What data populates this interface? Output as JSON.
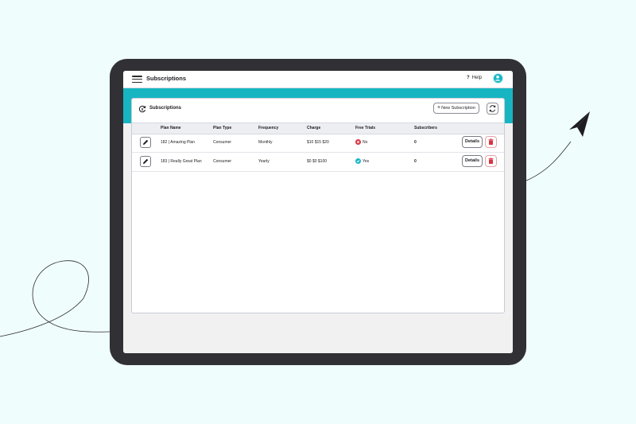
{
  "app": {
    "title": "Subscriptions",
    "help_label": "Help"
  },
  "panel": {
    "title": "Subscriptions",
    "new_button_label": "New Subscription"
  },
  "table": {
    "columns": [
      "Plan Name",
      "Plan Type",
      "Frequency",
      "Charge",
      "Free Trials",
      "Subscribers"
    ],
    "rows": [
      {
        "plan_name": "182 | Amazing Plan",
        "plan_type": "Consumer",
        "frequency": "Monthly",
        "charge": "$10 $15 $20",
        "free_trials": "No",
        "free_trial_status": "no",
        "subscribers": "0",
        "details_label": "Details"
      },
      {
        "plan_name": "183 | Really Great Plan",
        "plan_type": "Consumer",
        "frequency": "Yearly",
        "charge": "$0 $0 $100",
        "free_trials": "Yes",
        "free_trial_status": "yes",
        "subscribers": "0",
        "details_label": "Details"
      }
    ]
  },
  "icons": {
    "menu": "hamburger-icon",
    "help": "question-icon",
    "avatar": "user-avatar-icon",
    "panel": "subscription-cycle-icon",
    "refresh": "refresh-icon",
    "edit": "pencil-icon",
    "delete": "trash-icon",
    "trial_no": "x-circle-icon",
    "trial_yes": "check-circle-icon",
    "decor_plane": "paper-plane-icon"
  },
  "colors": {
    "page_background": "#f0fdfd",
    "device_frame": "#303035",
    "accent": "#17b5c2",
    "danger": "#d93342"
  }
}
